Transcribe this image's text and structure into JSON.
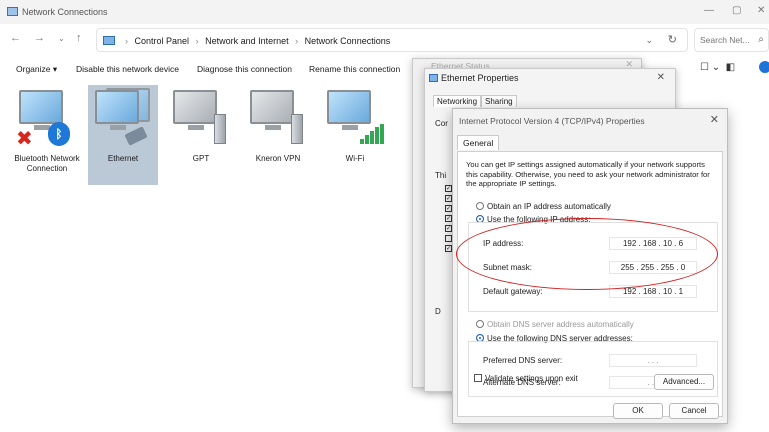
{
  "window": {
    "title": "Network Connections",
    "controls": [
      "—",
      "▢",
      "✕"
    ]
  },
  "address_bar": {
    "crumbs": [
      "Control Panel",
      "Network and Internet",
      "Network Connections"
    ],
    "search_placeholder": "Search Net..."
  },
  "toolbar": {
    "organize": "Organize ▾",
    "disable": "Disable this network device",
    "diagnose": "Diagnose this connection",
    "rename": "Rename this connection"
  },
  "adapters": [
    {
      "label": "Bluetooth Network Connection",
      "icon": "bluetooth-adapter-icon"
    },
    {
      "label": "Ethernet",
      "icon": "ethernet-adapter-icon"
    },
    {
      "label": "GPT",
      "icon": "network-adapter-icon"
    },
    {
      "label": "Kneron VPN",
      "icon": "vpn-adapter-icon"
    },
    {
      "label": "Wi-Fi",
      "icon": "wifi-adapter-icon"
    }
  ],
  "status_dialog": {
    "title": "Ethernet Status"
  },
  "props_dialog": {
    "title": "Ethernet Properties",
    "tabs": [
      "Networking",
      "Sharing"
    ],
    "frag_con": "Cor",
    "frag_this": "Thi",
    "frag_d": "D"
  },
  "ipv4_dialog": {
    "title": "Internet Protocol Version 4 (TCP/IPv4) Properties",
    "tab": "General",
    "info": "You can get IP settings assigned automatically if your network supports this capability. Otherwise, you need to ask your network administrator for the appropriate IP settings.",
    "obtain_ip": "Obtain an IP address automatically",
    "use_ip": "Use the following IP address:",
    "ip_label": "IP address:",
    "ip_value": "192 . 168 . 10 . 6",
    "mask_label": "Subnet mask:",
    "mask_value": "255 . 255 . 255 . 0",
    "gateway_label": "Default gateway:",
    "gateway_value": "192 . 168 . 10 . 1",
    "obtain_dns": "Obtain DNS server address automatically",
    "use_dns": "Use the following DNS server addresses:",
    "pref_dns_label": "Preferred DNS server:",
    "alt_dns_label": "Alternate DNS server:",
    "empty_ip": ". . .",
    "validate": "Validate settings upon exit",
    "advanced": "Advanced...",
    "ok": "OK",
    "cancel": "Cancel"
  },
  "colors": {
    "annotation": "#d02020",
    "selection": "#1e5fbf"
  }
}
